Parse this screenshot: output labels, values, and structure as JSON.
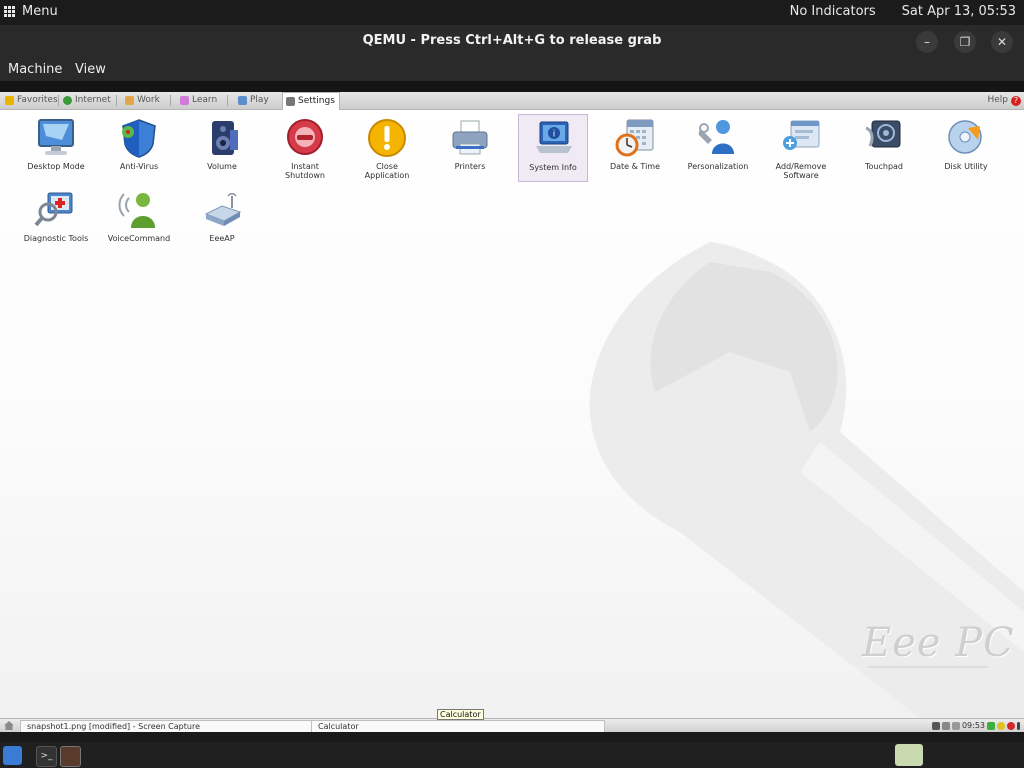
{
  "host_top": {
    "menu_label": "Menu",
    "indicators": "No Indicators",
    "datetime": "Sat Apr 13, 05:53"
  },
  "window": {
    "title": "QEMU - Press Ctrl+Alt+G to release grab",
    "menu": [
      "Machine",
      "View"
    ]
  },
  "guest": {
    "tabs": [
      {
        "label": "Favorites",
        "icon": "star-icon",
        "color": "#e8b400"
      },
      {
        "label": "Internet",
        "icon": "globe-icon",
        "color": "#3a9a3a"
      },
      {
        "label": "Work",
        "icon": "folder-icon",
        "color": "#e2a54a"
      },
      {
        "label": "Learn",
        "icon": "book-icon",
        "color": "#d27ad8"
      },
      {
        "label": "Play",
        "icon": "game-icon",
        "color": "#5a8fcf"
      },
      {
        "label": "Settings",
        "icon": "wrench-icon",
        "color": "#777777",
        "active": true
      }
    ],
    "help_label": "Help",
    "apps": [
      {
        "l1": "Desktop Mode",
        "l2": "",
        "icon": "monitor-icon"
      },
      {
        "l1": "Anti-Virus",
        "l2": "",
        "icon": "shield-icon"
      },
      {
        "l1": "Volume",
        "l2": "",
        "icon": "speaker-icon"
      },
      {
        "l1": "Instant",
        "l2": "Shutdown",
        "icon": "power-icon"
      },
      {
        "l1": "Close",
        "l2": "Application",
        "icon": "warning-icon"
      },
      {
        "l1": "Printers",
        "l2": "",
        "icon": "printer-icon"
      },
      {
        "l1": "System Info",
        "l2": "",
        "icon": "info-laptop-icon",
        "selected": true
      },
      {
        "l1": "Date & Time",
        "l2": "",
        "icon": "calendar-clock-icon"
      },
      {
        "l1": "Personalization",
        "l2": "",
        "icon": "user-tools-icon"
      },
      {
        "l1": "Add/Remove",
        "l2": "Software",
        "icon": "software-icon"
      },
      {
        "l1": "Touchpad",
        "l2": "",
        "icon": "touchpad-icon"
      },
      {
        "l1": "Disk Utility",
        "l2": "",
        "icon": "disk-icon"
      },
      {
        "l1": "Diagnostic Tools",
        "l2": "",
        "icon": "diagnostic-icon"
      },
      {
        "l1": "VoiceCommand",
        "l2": "",
        "icon": "voice-icon"
      },
      {
        "l1": "EeeAP",
        "l2": "",
        "icon": "router-icon"
      }
    ],
    "brand": "Eee PC",
    "taskbar": {
      "item1": "snapshot1.png [modified] - Screen Capture",
      "item2": "Calculator",
      "tooltip": "Calculator",
      "clock": "09:53"
    }
  }
}
